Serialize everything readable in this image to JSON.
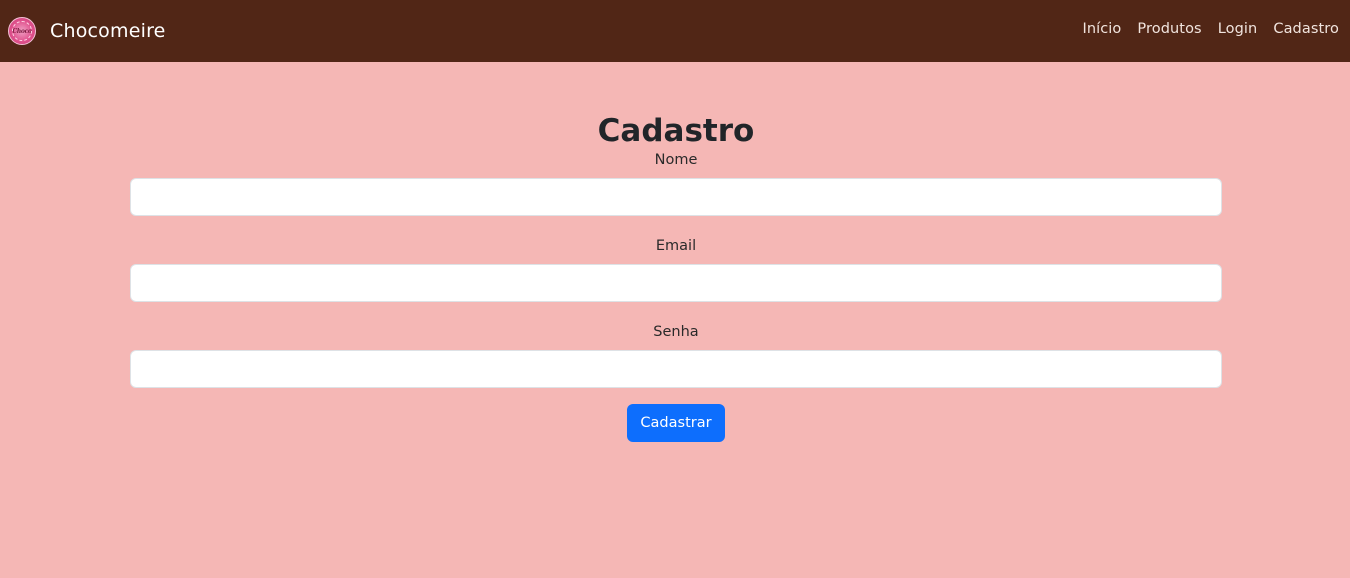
{
  "navbar": {
    "brand": "Chocomeire",
    "logo_text": "Choco",
    "links": [
      {
        "label": "Início"
      },
      {
        "label": "Produtos"
      },
      {
        "label": "Login"
      },
      {
        "label": "Cadastro"
      }
    ]
  },
  "form": {
    "title": "Cadastro",
    "fields": [
      {
        "label": "Nome",
        "value": ""
      },
      {
        "label": "Email",
        "value": ""
      },
      {
        "label": "Senha",
        "value": ""
      }
    ],
    "submit_label": "Cadastrar"
  },
  "colors": {
    "navbar_bg": "#512616",
    "page_bg": "#f5b7b5",
    "button_bg": "#0d6efd"
  },
  "icons": {
    "logo": "chocomeire-logo-icon"
  }
}
